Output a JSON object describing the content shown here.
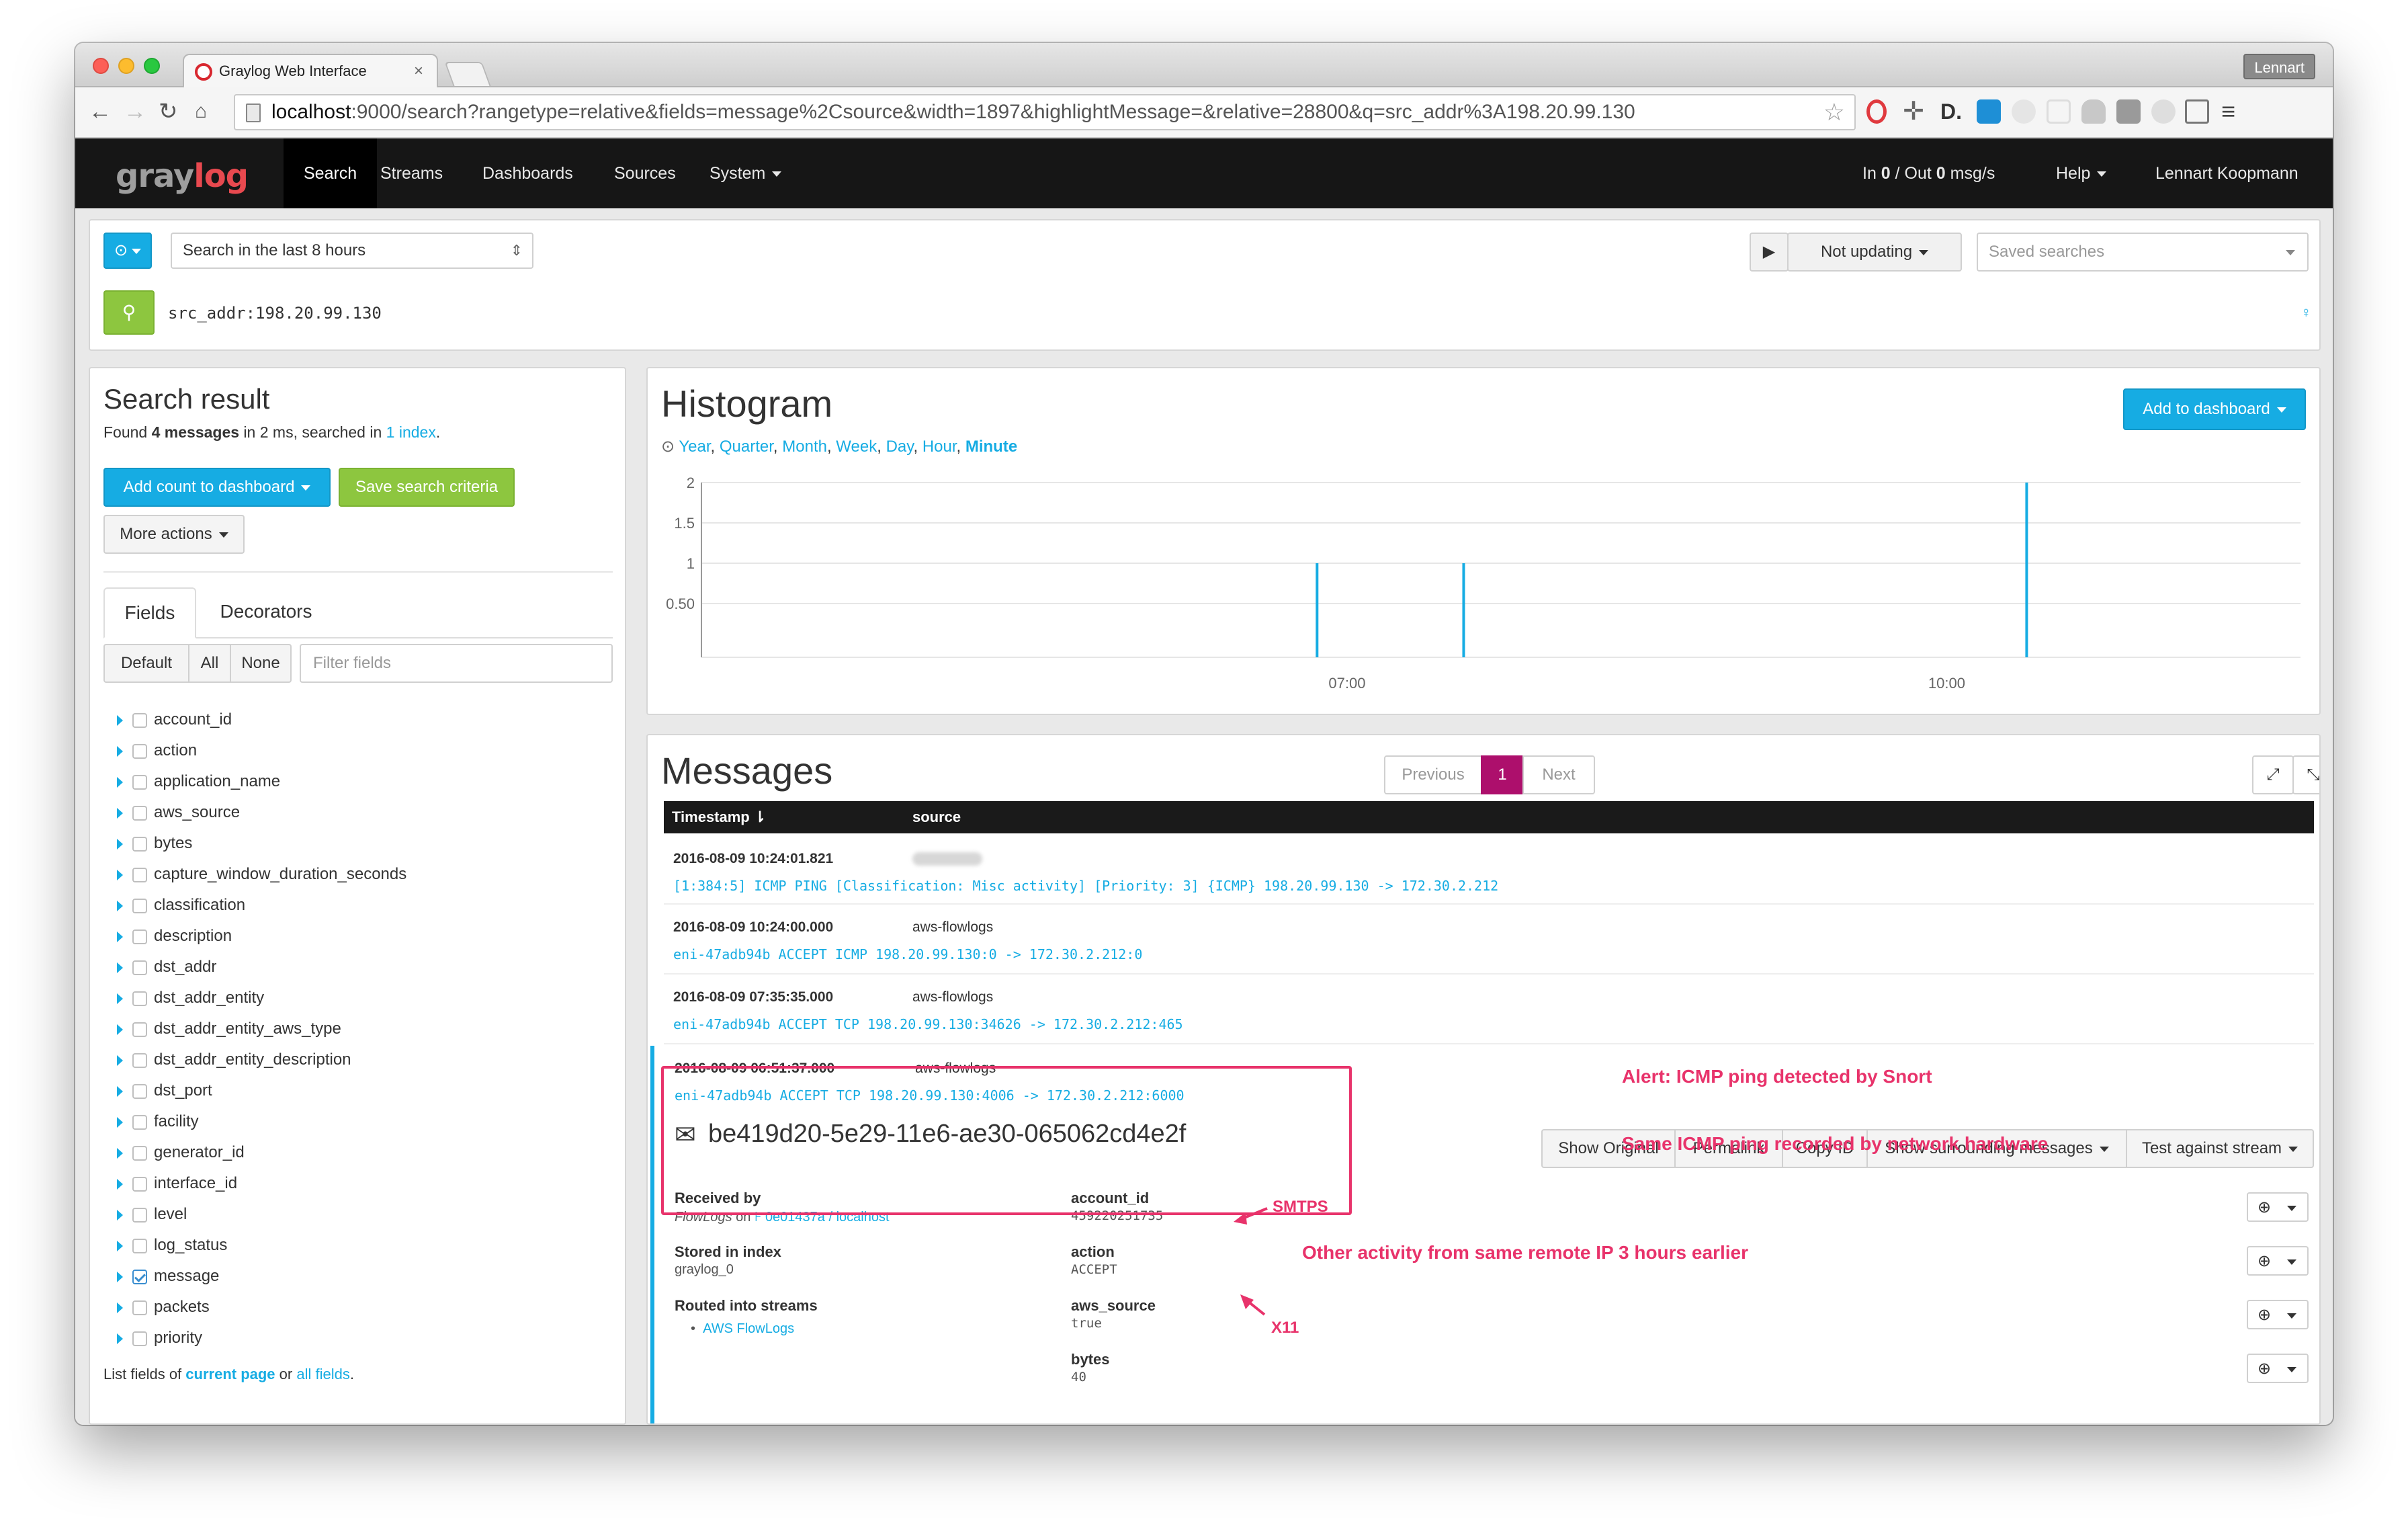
{
  "browser": {
    "tab_title": "Graylog Web Interface",
    "user_button": "Lennart",
    "url_host": "localhost",
    "url_rest": ":9000/search?rangetype=relative&fields=message%2Csource&width=1897&highlightMessage=&relative=28800&q=src_addr%3A198.20.99.130"
  },
  "nav": {
    "logo_gray": "gray",
    "logo_red": "log",
    "items": [
      "Search",
      "Streams",
      "Dashboards",
      "Sources",
      "System"
    ],
    "throughput_prefix": "In ",
    "throughput_in": "0",
    "throughput_mid": " / Out ",
    "throughput_out": "0",
    "throughput_suffix": " msg/s",
    "help": "Help",
    "user": "Lennart Koopmann"
  },
  "search": {
    "range": "Search in the last 8 hours",
    "not_updating": "Not updating",
    "saved_searches_placeholder": "Saved searches",
    "query": "src_addr:198.20.99.130"
  },
  "result": {
    "title": "Search result",
    "found_prefix": "Found ",
    "found_count": "4 messages",
    "found_mid": " in 2 ms, searched in ",
    "found_index": "1 index",
    "found_suffix": ".",
    "add_count_btn": "Add count to dashboard",
    "save_btn": "Save search criteria",
    "more_actions": "More actions",
    "tabs": [
      "Fields",
      "Decorators"
    ],
    "filter_buttons": [
      "Default",
      "All",
      "None"
    ],
    "filter_placeholder": "Filter fields",
    "fields": [
      "account_id",
      "action",
      "application_name",
      "aws_source",
      "bytes",
      "capture_window_duration_seconds",
      "classification",
      "description",
      "dst_addr",
      "dst_addr_entity",
      "dst_addr_entity_aws_type",
      "dst_addr_entity_description",
      "dst_port",
      "facility",
      "generator_id",
      "interface_id",
      "level",
      "log_status",
      "message",
      "packets",
      "priority"
    ],
    "checked_field": "message",
    "list_prefix": "List fields of ",
    "list_current": "current page",
    "list_mid": " or ",
    "list_all": "all fields",
    "list_suffix": "."
  },
  "histogram": {
    "title": "Histogram",
    "resolutions": [
      "Year",
      "Quarter",
      "Month",
      "Week",
      "Day",
      "Hour",
      "Minute"
    ],
    "active_resolution": "Minute",
    "add_btn": "Add to dashboard"
  },
  "chart_data": {
    "type": "bar",
    "x": [
      "06:51",
      "07:35",
      "10:24"
    ],
    "values": [
      1,
      1,
      2
    ],
    "ylim": [
      0,
      2
    ],
    "yticks": [
      "2",
      "1.5",
      "1",
      "0.50"
    ],
    "xticks": [
      "07:00",
      "10:00"
    ],
    "xlim_hours": [
      3.77,
      11.77
    ],
    "color": "#16ace3",
    "grid": true
  },
  "messages": {
    "title": "Messages",
    "pager": {
      "previous": "Previous",
      "current": "1",
      "next": "Next"
    },
    "col_timestamp": "Timestamp",
    "col_source": "source",
    "rows": [
      {
        "timestamp": "2016-08-09 10:24:01.821",
        "source": "",
        "message": "[1:384:5] ICMP PING [Classification: Misc activity] [Priority: 3] {ICMP} 198.20.99.130 -> 172.30.2.212"
      },
      {
        "timestamp": "2016-08-09 10:24:00.000",
        "source": "aws-flowlogs",
        "message": "eni-47adb94b ACCEPT ICMP 198.20.99.130:0 -> 172.30.2.212:0"
      },
      {
        "timestamp": "2016-08-09 07:35:35.000",
        "source": "aws-flowlogs",
        "message": "eni-47adb94b ACCEPT TCP 198.20.99.130:34626 -> 172.30.2.212:465"
      },
      {
        "timestamp": "2016-08-09 06:51:37.000",
        "source": "aws-flowlogs",
        "message": "eni-47adb94b ACCEPT TCP 198.20.99.130:4006 -> 172.30.2.212:6000"
      }
    ],
    "detail": {
      "id": "be419d20-5e29-11e6-ae30-065062cd4e2f",
      "actions": [
        "Show Original",
        "Permalink",
        "Copy ID",
        "Show surrounding messages",
        "Test against stream"
      ],
      "received_by_label": "Received by",
      "received_by_input": "FlowLogs",
      "received_on": " on ",
      "received_node": "0e01437a / localhost",
      "stored_label": "Stored in index",
      "stored_value": "graylog_0",
      "routed_label": "Routed into streams",
      "routed_value": "AWS FlowLogs",
      "fields": [
        {
          "name": "account_id",
          "value": "459220251735"
        },
        {
          "name": "action",
          "value": "ACCEPT"
        },
        {
          "name": "aws_source",
          "value": "true"
        },
        {
          "name": "bytes",
          "value": "40"
        }
      ]
    }
  },
  "annotations": {
    "alert": "Alert: ICMP ping detected by Snort",
    "same": "Same ICMP ping recorded by network hardware",
    "smtps": "SMTPS",
    "other": "Other activity from same remote IP 3 hours earlier",
    "x11": "X11",
    "color": "#e8336b"
  }
}
